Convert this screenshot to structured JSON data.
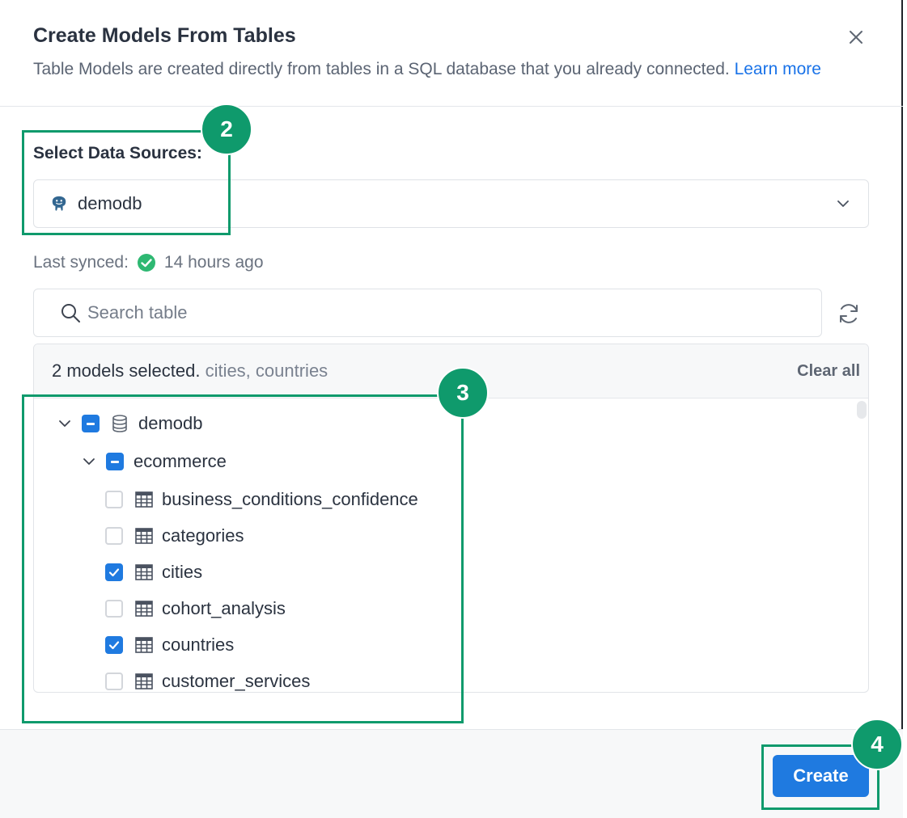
{
  "dialog": {
    "title": "Create Models From Tables",
    "subtitle": "Table Models are created directly from tables in a SQL database that you already connected.",
    "learn_more": "Learn more"
  },
  "data_source": {
    "label": "Select Data Sources:",
    "selected": "demodb",
    "icon": "postgresql-icon"
  },
  "sync": {
    "label": "Last synced:",
    "value": "14 hours ago"
  },
  "search": {
    "placeholder": "Search table",
    "value": ""
  },
  "selection": {
    "summary": "2 models selected.",
    "names": "cities, countries",
    "clear_label": "Clear all"
  },
  "tree": {
    "database": {
      "label": "demodb",
      "state": "partial"
    },
    "schema": {
      "label": "ecommerce",
      "state": "partial"
    },
    "tables": [
      {
        "label": "business_conditions_confidence",
        "checked": false
      },
      {
        "label": "categories",
        "checked": false
      },
      {
        "label": "cities",
        "checked": true
      },
      {
        "label": "cohort_analysis",
        "checked": false
      },
      {
        "label": "countries",
        "checked": true
      },
      {
        "label": "customer_services",
        "checked": false
      }
    ]
  },
  "footer": {
    "create_label": "Create"
  },
  "annotations": {
    "badges": [
      "2",
      "3",
      "4"
    ],
    "color": "#0f9a6c"
  },
  "colors": {
    "accent": "#1f7ae0",
    "link": "#1a73e8",
    "success": "#2eb872"
  }
}
